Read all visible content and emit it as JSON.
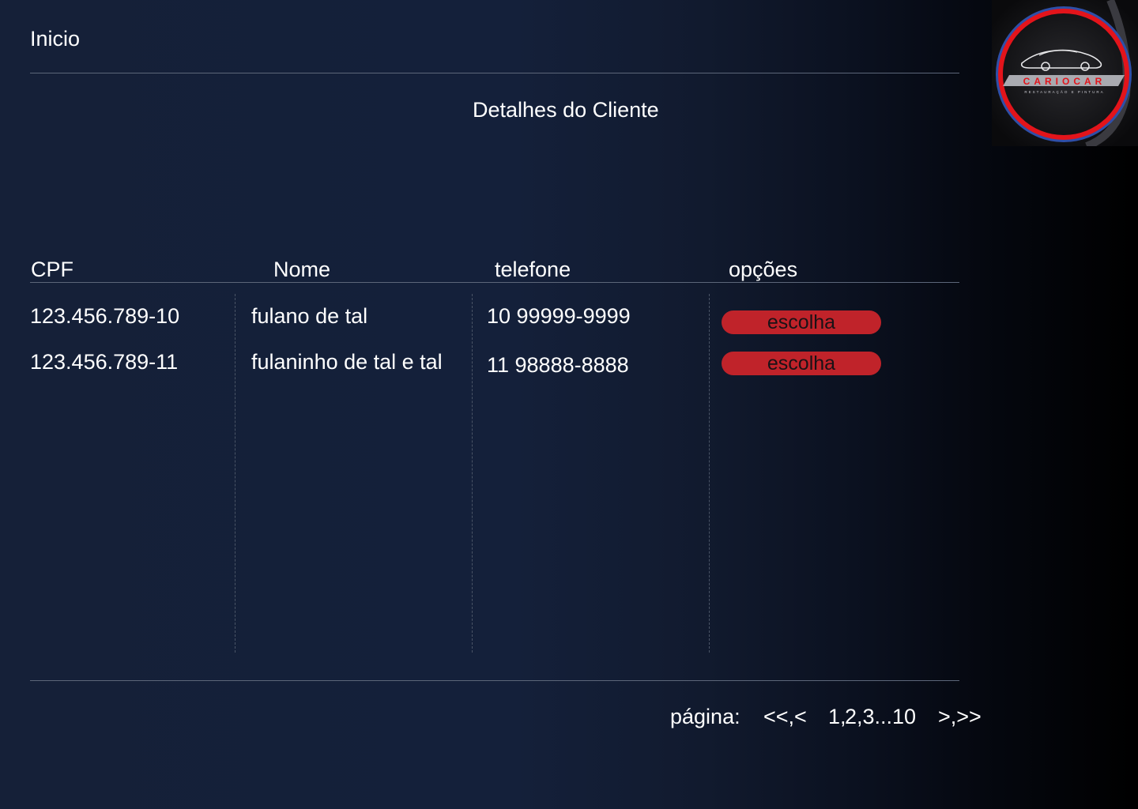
{
  "nav": {
    "home_label": "Inicio"
  },
  "page": {
    "title": "Detalhes do Cliente"
  },
  "logo": {
    "brand": "CARIOCAR",
    "tagline": "RESTAURAÇÃO E PINTURA",
    "ring_color": "#e3141b",
    "accent_blue": "#2f4fa8"
  },
  "table": {
    "columns": [
      "CPF",
      "Nome",
      "telefone",
      "opções"
    ],
    "rows": [
      {
        "cpf": "123.456.789-10",
        "nome": "fulano de tal",
        "telefone": "10 99999-9999",
        "action": "escolha"
      },
      {
        "cpf": "123.456.789-11",
        "nome": "fulaninho de tal e tal",
        "telefone": "11 98888-8888",
        "action": "escolha"
      }
    ]
  },
  "pagination": {
    "label": "página:",
    "first_prev": "<<,<",
    "current": "1,",
    "other_pages": "2,3...10",
    "next_last": ">,>>"
  },
  "colors": {
    "button": "#c0232a",
    "rule": "#5c6679"
  }
}
